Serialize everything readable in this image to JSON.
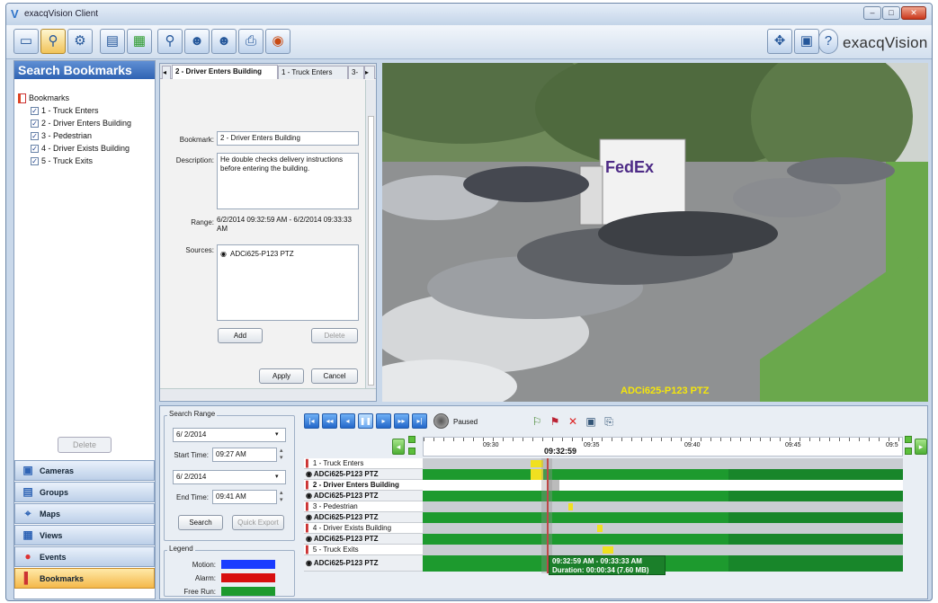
{
  "window": {
    "title": "exacqVision Client",
    "brand": "exacqVision"
  },
  "left_panel": {
    "header": "Search  Bookmarks",
    "tree_root": "Bookmarks",
    "bookmarks": [
      "1 - Truck Enters",
      "2 - Driver Enters Building",
      "3 - Pedestrian",
      "4 - Driver Exists Building",
      "5 - Truck Exits"
    ],
    "delete_label": "Delete",
    "nav": [
      "Cameras",
      "Groups",
      "Maps",
      "Views",
      "Events",
      "Bookmarks"
    ]
  },
  "form": {
    "tabs": [
      "2 - Driver Enters Building",
      "1 - Truck Enters",
      "3-"
    ],
    "bookmark_label": "Bookmark:",
    "bookmark_value": "2 - Driver Enters Building",
    "description_label": "Description:",
    "description_value": "He double checks delivery instructions before entering the building.",
    "range_label": "Range:",
    "range_value": "6/2/2014 09:32:59 AM - 6/2/2014 09:33:33 AM",
    "sources_label": "Sources:",
    "source_item": "ADCi625-P123 PTZ",
    "add_label": "Add",
    "delete_label": "Delete",
    "apply_label": "Apply",
    "cancel_label": "Cancel"
  },
  "video": {
    "overlay": "ADCi625-P123 PTZ",
    "truck_text": "FedEx"
  },
  "search": {
    "range_title": "Search Range",
    "start_date": "6/ 2/2014",
    "start_time_label": "Start Time:",
    "start_time": "09:27 AM",
    "end_date": "6/ 2/2014",
    "end_time_label": "End Time:",
    "end_time": "09:41 AM",
    "search_label": "Search",
    "quick_export_label": "Quick Export",
    "legend_title": "Legend",
    "legend": [
      {
        "label": "Motion:",
        "color": "#1a3cff"
      },
      {
        "label": "Alarm:",
        "color": "#d80f0f"
      },
      {
        "label": "Free Run:",
        "color": "#1d9a2e"
      }
    ]
  },
  "playback": {
    "status": "Paused"
  },
  "timeline": {
    "ticks": [
      "09:30",
      "09:35",
      "09:40",
      "09:45",
      "09:5"
    ],
    "cursor_time": "09:32:59",
    "rows": [
      {
        "bookmark": "1 - Truck Enters",
        "camera": "ADCi625-P123 PTZ"
      },
      {
        "bookmark": "2 - Driver Enters Building",
        "camera": "ADCi625-P123 PTZ"
      },
      {
        "bookmark": "3 - Pedestrian",
        "camera": "ADCi625-P123 PTZ"
      },
      {
        "bookmark": "4 - Driver Exists Building",
        "camera": "ADCi625-P123 PTZ"
      },
      {
        "bookmark": "5 - Truck Exits",
        "camera": "ADCi625-P123 PTZ"
      }
    ],
    "tooltip_range": "09:32:59 AM - 09:33:33 AM",
    "tooltip_duration": "Duration: 00:00:34 (7.60 MB)"
  }
}
